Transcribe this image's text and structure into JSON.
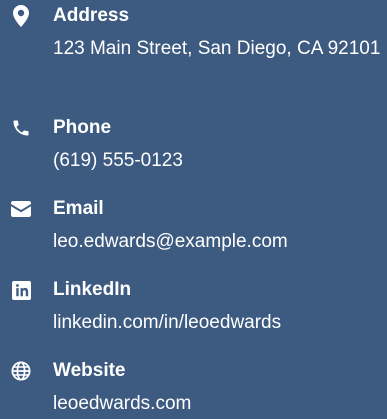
{
  "contact": {
    "address": {
      "icon": "map-marker-icon",
      "label": "Address",
      "value": "123 Main Street, San Diego, CA 92101"
    },
    "phone": {
      "icon": "phone-icon",
      "label": "Phone",
      "value": "(619) 555-0123"
    },
    "email": {
      "icon": "envelope-icon",
      "label": "Email",
      "value": "leo.edwards@example.com"
    },
    "linkedin": {
      "icon": "linkedin-icon",
      "label": "LinkedIn",
      "value": "linkedin.com/in/leoedwards"
    },
    "website": {
      "icon": "globe-icon",
      "label": "Website",
      "value": "leoedwards.com"
    }
  },
  "colors": {
    "background": "#3d5a80",
    "text": "#ffffff"
  }
}
